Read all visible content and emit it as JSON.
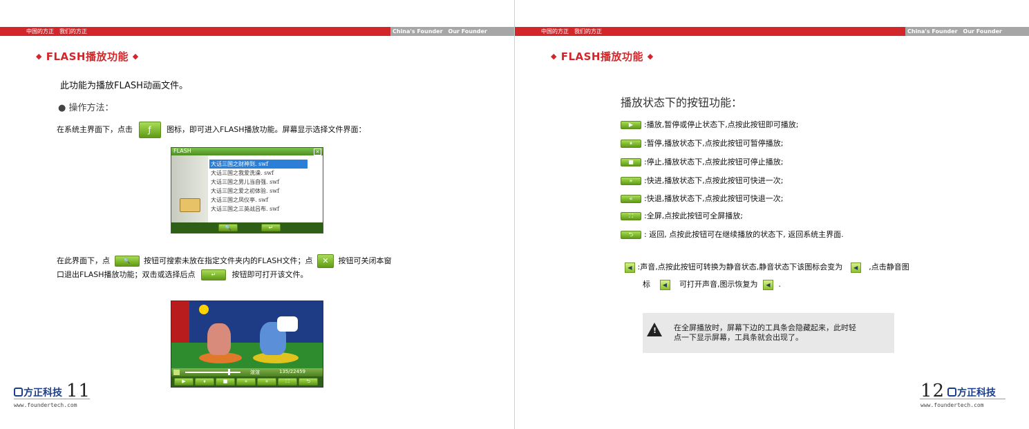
{
  "header": {
    "cn": "中国的方正　我们的方正",
    "en": "China's Founder　Our Founder"
  },
  "section_title": "FLASH播放功能",
  "diamond": "◆",
  "left": {
    "intro": "此功能为播放FLASH动画文件。",
    "method_label": "● 操作方法：",
    "step1_a": "在系统主界面下，点击",
    "step1_b": "图标，即可进入FLASH播放功能。屏幕显示选择文件界面：",
    "dialog": {
      "title": "FLASH",
      "close": "✕",
      "files": [
        "大话三国之财神到. swf",
        "大话三国之我爱洗澡. swf",
        "大话三国之男儿当自强. swf",
        "大话三国之爱之初体验. swf",
        "大话三国之凤仪亭. swf",
        "大话三国之三英战吕布. swf"
      ],
      "search_btn": "🔍",
      "enter_btn": "↵"
    },
    "step2_a": "在此界面下，点",
    "step2_b": "按钮可搜索未放在指定文件夹内的FLASH文件；点",
    "step2_c": "按钮可关闭本窗",
    "step2_d": "口退出FLASH播放功能；双击或选择后点",
    "step2_e": "按钮即可打开该文件。",
    "player": {
      "mode": "渲渲",
      "time": "135/22459",
      "buttons": [
        "▶",
        "⏸",
        "■",
        "«",
        "»",
        "⛶",
        "⮌"
      ]
    },
    "page_number": "11",
    "logo": "方正科技",
    "url": "www.foundertech.com"
  },
  "right": {
    "subtitle": "播放状态下的按钮功能：",
    "rows": [
      {
        "icon": "▶",
        "text": ":播放,暂停或停止状态下,点按此按钮即可播放;"
      },
      {
        "icon": "⏸",
        "text": ":暂停,播放状态下,点按此按钮可暂停播放;"
      },
      {
        "icon": "■",
        "text": ":停止,播放状态下,点按此按钮可停止播放;"
      },
      {
        "icon": "»",
        "text": ":快进,播放状态下,点按此按钮可快进一次;"
      },
      {
        "icon": "«",
        "text": ":快退,播放状态下,点按此按钮可快退一次;"
      },
      {
        "icon": "⛶",
        "text": ":全屏,点按此按钮可全屏播放;"
      },
      {
        "icon": "⮌",
        "text": ": 返回, 点按此按钮可在继续播放的状态下, 返回系统主界面."
      }
    ],
    "sound_a": ":声音,点按此按钮可转换为静音状态,静音状态下该图标会变为",
    "sound_b": ",点击静音图",
    "sound_c": "标",
    "sound_d": "可打开声音,图示恢复为",
    "sound_e": ".",
    "note_1": "在全屏播放时，屏幕下边的工具条会隐藏起来，此时轻",
    "note_2": "点一下显示屏幕，工具条就会出现了。",
    "page_number": "12",
    "logo": "方正科技",
    "url": "www.foundertech.com"
  }
}
